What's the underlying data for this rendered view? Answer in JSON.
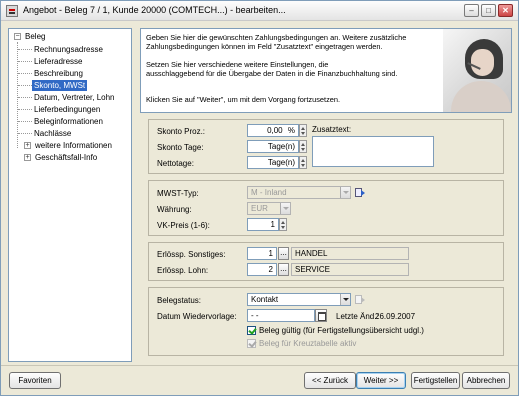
{
  "window": {
    "title": "Angebot - Beleg 7 / 1, Kunde 20000 (COMTECH...) - bearbeiten...",
    "controls": [
      "–",
      "□",
      "✕"
    ]
  },
  "tree": {
    "root": "Beleg",
    "children": [
      "Rechnungsadresse",
      "Lieferadresse",
      "Beschreibung",
      "Skonto, MWSt",
      "Datum, Vertreter, Lohn",
      "Lieferbedingungen",
      "Beleginformationen",
      "Nachlässe"
    ],
    "selected": "Skonto, MWSt",
    "collapsed": [
      "weitere Informationen",
      "Geschäftsfall-Info"
    ]
  },
  "info": {
    "line1": "Geben Sie hier die gewünschten Zahlungsbedingungen an. Weitere zusätzliche",
    "line2": "Zahlungsbedingungen können im Feld \"Zusatztext\" eingetragen werden.",
    "line3": "Setzen Sie hier verschiedene weitere Einstellungen, die",
    "line4": "ausschlaggebend für die Übergabe der Daten in die Finanzbuchhaltung sind.",
    "line5": "Klicken Sie auf \"Weiter\", um mit dem Vorgang fortzusetzen."
  },
  "skonto": {
    "proz_label": "Skonto Proz.:",
    "proz_value": "0,00",
    "proz_unit": "%",
    "tage_label": "Skonto Tage:",
    "tage_value": "Tage(n)",
    "netto_label": "Nettotage:",
    "netto_value": "Tage(n)",
    "zusatz_label": "Zusatztext:"
  },
  "mwst": {
    "typ_label": "MWST-Typ:",
    "typ_value": "M - Inland",
    "waehrung_label": "Währung:",
    "waehrung_value": "EUR",
    "vkpreis_label": "VK-Preis (1-6):",
    "vkpreis_value": "1"
  },
  "erloes": {
    "sonstiges_label": "Erlössp. Sonstiges:",
    "sonstiges_num": "1",
    "sonstiges_name": "HANDEL",
    "lohn_label": "Erlössp. Lohn:",
    "lohn_num": "2",
    "lohn_name": "SERVICE"
  },
  "status": {
    "belegstatus_label": "Belegstatus:",
    "belegstatus_value": "Kontakt",
    "wiedervorlage_label": "Datum Wiedervorlage:",
    "wiedervorlage_value": "- -",
    "letzte_aend_label": "Letzte Änd.:",
    "letzte_aend_value": "26.09.2007",
    "chk_gueltig_label": "Beleg gültig (für Fertigstellungsübersicht udgl.)",
    "chk_gueltig_checked": true,
    "chk_kreuz_label": "Beleg für Kreuztabelle aktiv",
    "chk_kreuz_checked": true
  },
  "buttons": {
    "favoriten": "Favoriten",
    "zurueck": "<< Zurück",
    "weiter": "Weiter >>",
    "fertigstellen": "Fertigstellen",
    "abbrechen": "Abbrechen"
  },
  "icons": {
    "ellipsis": "...",
    "tree_minus": "−",
    "tree_plus": "+"
  },
  "colors": {
    "selection": "#316ac5",
    "window_bg": "#ece9d8",
    "field_border": "#7f9db9"
  }
}
